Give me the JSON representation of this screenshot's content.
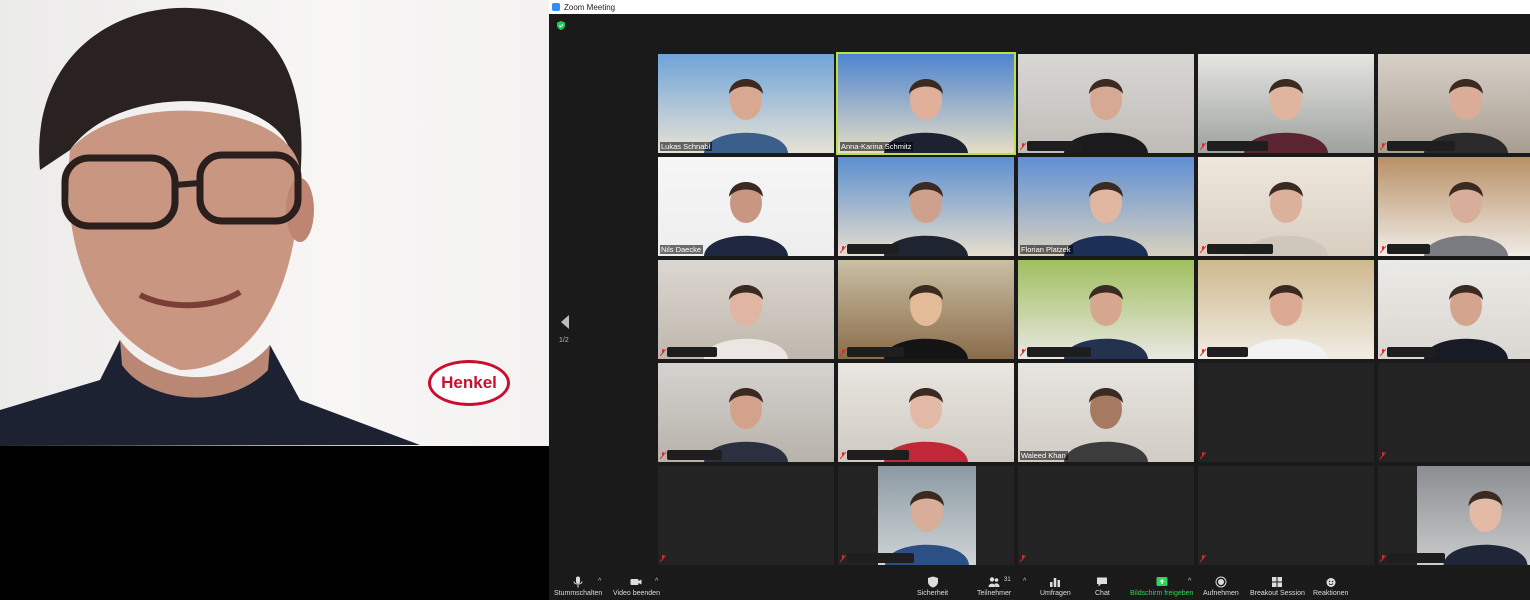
{
  "window": {
    "title": "Zoom Meeting"
  },
  "speaker": {
    "logo_text": "Henkel"
  },
  "gallery": {
    "page_indicator": "1/2",
    "tiles": [
      {
        "name": "Lukas Schnabl"
      },
      {
        "name": "Anna-Karina Schmitz"
      },
      {
        "name": ""
      },
      {
        "name": ""
      },
      {
        "name": ""
      },
      {
        "name": "Nils Daecke"
      },
      {
        "name": ""
      },
      {
        "name": "Florian Platzek"
      },
      {
        "name": ""
      },
      {
        "name": ""
      },
      {
        "name": ""
      },
      {
        "name": ""
      },
      {
        "name": ""
      },
      {
        "name": ""
      },
      {
        "name": ""
      },
      {
        "name": ""
      },
      {
        "name": ""
      },
      {
        "name": "Waleed Khan"
      },
      {
        "name": ""
      },
      {
        "name": ""
      },
      {
        "name": ""
      },
      {
        "name": ""
      },
      {
        "name": ""
      },
      {
        "name": ""
      },
      {
        "name": ""
      }
    ]
  },
  "toolbar": {
    "mute": "Stummschalten",
    "video": "Video beenden",
    "security": "Sicherheit",
    "participants": "Teilnehmer",
    "participants_count": "31",
    "polls": "Umfragen",
    "chat": "Chat",
    "share": "Bildschirm freigeben",
    "record": "Aufnehmen",
    "breakout": "Breakout Session",
    "reactions": "Reaktionen"
  },
  "colors": {
    "active_speaker_border": "#b8e04a",
    "share_green": "#2bd45b",
    "background": "#1a1a1a"
  }
}
